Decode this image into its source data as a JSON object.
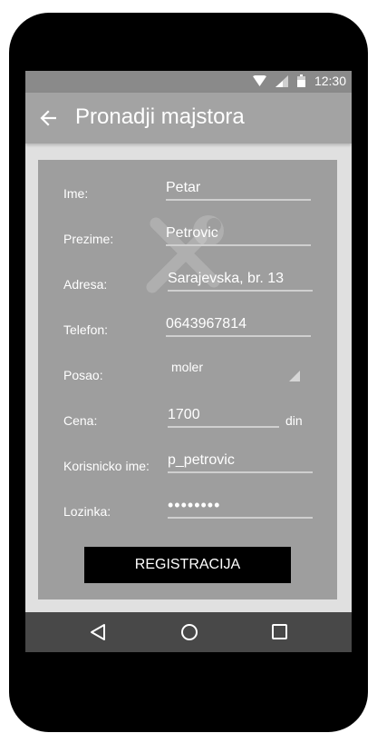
{
  "status_bar": {
    "time": "12:30"
  },
  "app_bar": {
    "title": "Pronadji majstora"
  },
  "form": {
    "ime": {
      "label": "Ime:",
      "value": "Petar"
    },
    "prezime": {
      "label": "Prezime:",
      "value": "Petrovic"
    },
    "adresa": {
      "label": "Adresa:",
      "value": "Sarajevska, br. 13"
    },
    "telefon": {
      "label": "Telefon:",
      "value": "0643967814"
    },
    "posao": {
      "label": "Posao:",
      "value": "moler"
    },
    "cena": {
      "label": "Cena:",
      "value": "1700",
      "unit": "din"
    },
    "korisnicko_ime": {
      "label": "Korisnicko ime:",
      "value": "p_petrovic"
    },
    "lozinka": {
      "label": "Lozinka:",
      "value": "••••••••"
    },
    "submit_label": "REGISTRACIJA"
  },
  "colors": {
    "status_bar": "#8a8a8a",
    "app_bar": "#a3a3a3",
    "card": "#9e9e9e",
    "nav_bar": "#484848",
    "button": "#000000"
  },
  "icons": {
    "status": [
      "wifi-icon",
      "cell-signal-icon",
      "battery-icon"
    ],
    "back": "arrow-left-icon",
    "background": "wrench-icon",
    "nav": [
      "nav-back-icon",
      "nav-home-icon",
      "nav-recents-icon"
    ]
  }
}
